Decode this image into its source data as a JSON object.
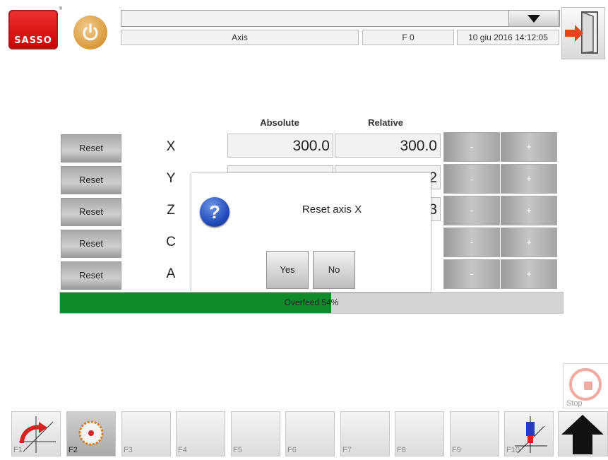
{
  "header": {
    "logo_text": "SASSO",
    "mode": "Axis",
    "feed": "F 0",
    "datetime": "10 giu 2016 14:12:05"
  },
  "columns": {
    "absolute": "Absolute",
    "relative": "Relative"
  },
  "axes": [
    {
      "label": "X",
      "reset": "Reset",
      "minus": "-",
      "plus": "+",
      "absolute": "300.0",
      "relative": "300.0"
    },
    {
      "label": "Y",
      "reset": "Reset",
      "minus": "-",
      "plus": "+"
    },
    {
      "label": "Z",
      "reset": "Reset",
      "minus": "-",
      "plus": "+"
    },
    {
      "label": "C",
      "reset": "Reset",
      "minus": "-",
      "plus": "+"
    },
    {
      "label": "A",
      "reset": "Reset",
      "minus": "-",
      "plus": "+"
    }
  ],
  "partial_values": {
    "y_relative_tail": "2",
    "z_relative_tail": "3"
  },
  "overfeed": {
    "label": "Overfeed 54%",
    "percent": 54
  },
  "dialog": {
    "message": "Reset axis X",
    "yes": "Yes",
    "no": "No"
  },
  "stop": {
    "label": "Stop"
  },
  "function_keys": [
    "F1",
    "F2",
    "F3",
    "F4",
    "F5",
    "F6",
    "F7",
    "F8",
    "F9",
    "F10"
  ],
  "colors": {
    "progress_fill": "#0f8a2a",
    "dialog_icon": "#1f48b9",
    "logo": "#d41a1a"
  }
}
